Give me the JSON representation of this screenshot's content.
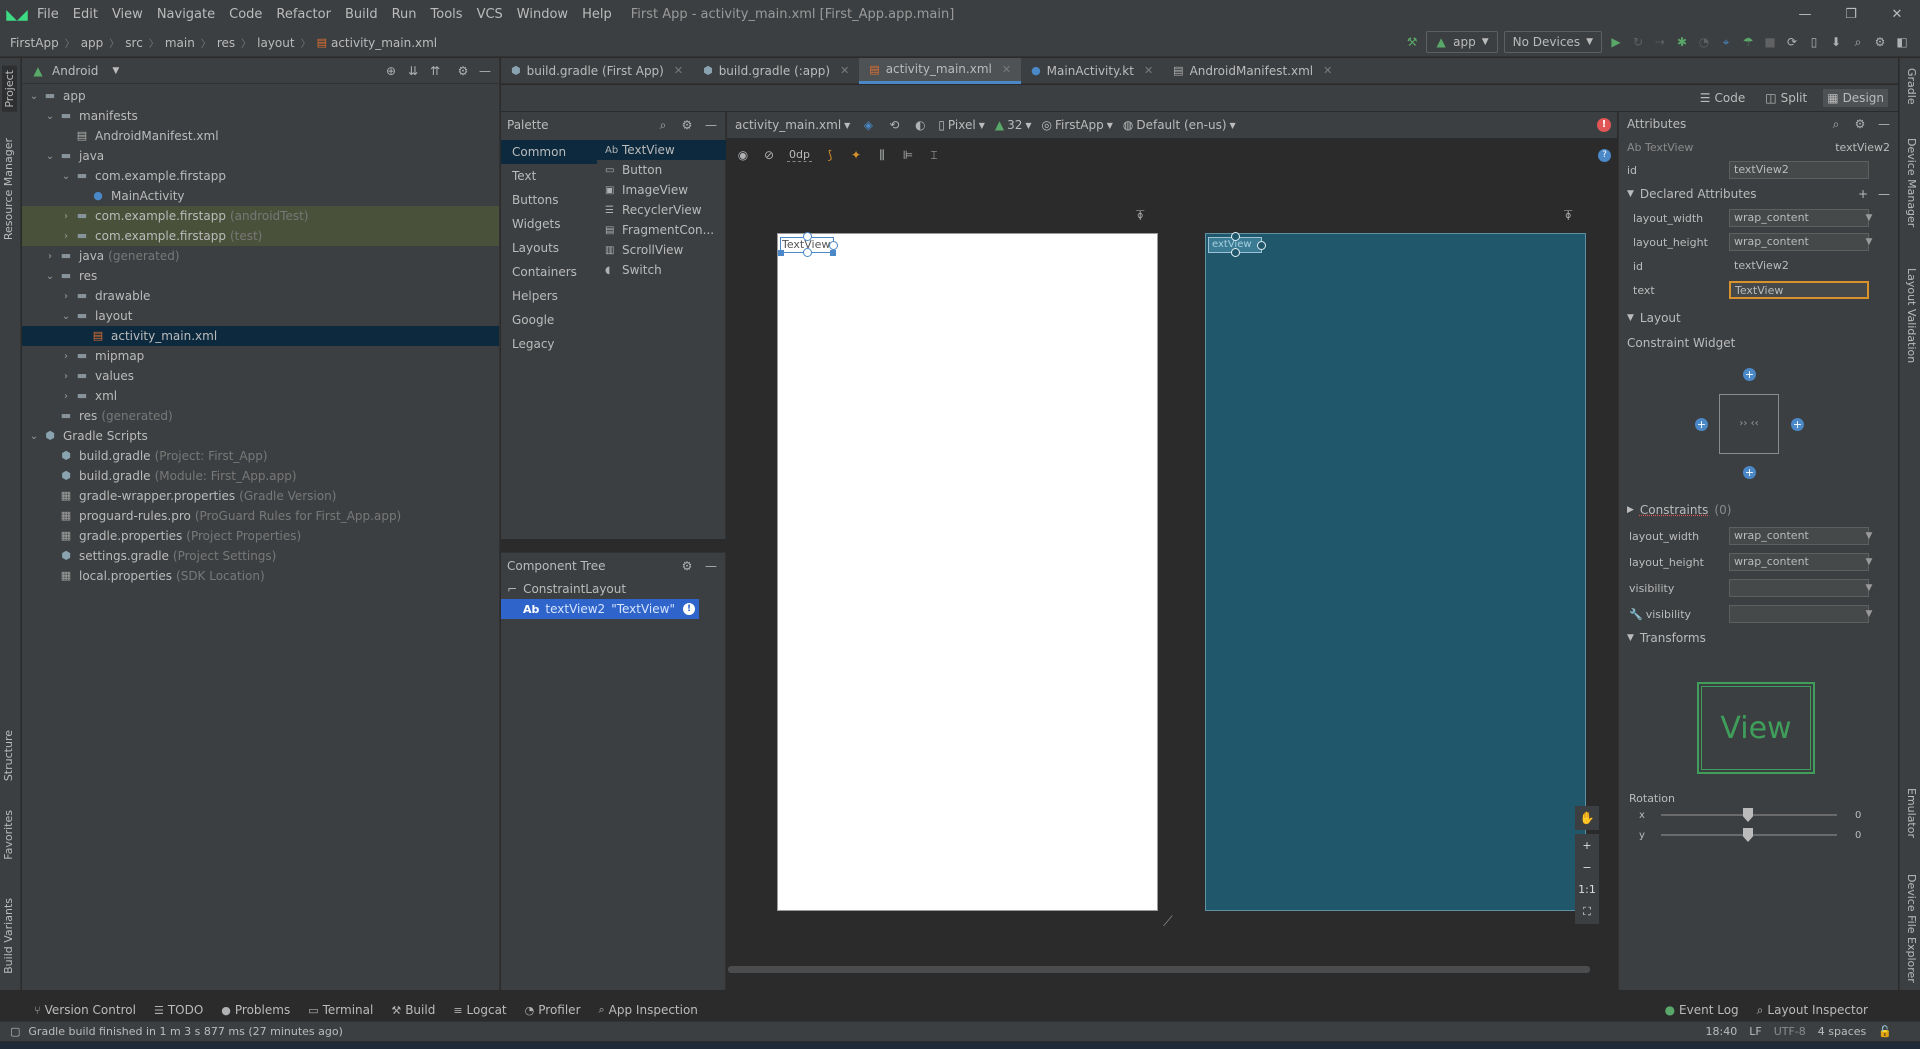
{
  "titlebar": {
    "menus": [
      "File",
      "Edit",
      "View",
      "Navigate",
      "Code",
      "Refactor",
      "Build",
      "Run",
      "Tools",
      "VCS",
      "Window",
      "Help"
    ],
    "title": "First App - activity_main.xml [First_App.app.main]"
  },
  "breadcrumb": [
    "FirstApp",
    "app",
    "src",
    "main",
    "res",
    "layout",
    "activity_main.xml"
  ],
  "toolbar": {
    "config": "app",
    "device": "No Devices"
  },
  "project": {
    "view": "Android",
    "tree": [
      {
        "label": "app",
        "dim": "",
        "depth": 0,
        "arrow": "v",
        "icon": "folder",
        "style": ""
      },
      {
        "label": "manifests",
        "dim": "",
        "depth": 1,
        "arrow": "v",
        "icon": "folder",
        "style": ""
      },
      {
        "label": "AndroidManifest.xml",
        "dim": "",
        "depth": 2,
        "arrow": "",
        "icon": "manifest",
        "style": ""
      },
      {
        "label": "java",
        "dim": "",
        "depth": 1,
        "arrow": "v",
        "icon": "folder",
        "style": ""
      },
      {
        "label": "com.example.firstapp",
        "dim": "",
        "depth": 2,
        "arrow": "v",
        "icon": "package",
        "style": ""
      },
      {
        "label": "MainActivity",
        "dim": "",
        "depth": 3,
        "arrow": "",
        "icon": "kotlin",
        "style": ""
      },
      {
        "label": "com.example.firstapp",
        "dim": "(androidTest)",
        "depth": 2,
        "arrow": ">",
        "icon": "package",
        "style": "hl"
      },
      {
        "label": "com.example.firstapp",
        "dim": "(test)",
        "depth": 2,
        "arrow": ">",
        "icon": "package",
        "style": "hl"
      },
      {
        "label": "java",
        "dim": "(generated)",
        "depth": 1,
        "arrow": ">",
        "icon": "folder",
        "style": ""
      },
      {
        "label": "res",
        "dim": "",
        "depth": 1,
        "arrow": "v",
        "icon": "folder",
        "style": ""
      },
      {
        "label": "drawable",
        "dim": "",
        "depth": 2,
        "arrow": ">",
        "icon": "folder",
        "style": ""
      },
      {
        "label": "layout",
        "dim": "",
        "depth": 2,
        "arrow": "v",
        "icon": "folder",
        "style": ""
      },
      {
        "label": "activity_main.xml",
        "dim": "",
        "depth": 3,
        "arrow": "",
        "icon": "layout",
        "style": "sel"
      },
      {
        "label": "mipmap",
        "dim": "",
        "depth": 2,
        "arrow": ">",
        "icon": "folder",
        "style": ""
      },
      {
        "label": "values",
        "dim": "",
        "depth": 2,
        "arrow": ">",
        "icon": "folder",
        "style": ""
      },
      {
        "label": "xml",
        "dim": "",
        "depth": 2,
        "arrow": ">",
        "icon": "folder",
        "style": ""
      },
      {
        "label": "res",
        "dim": "(generated)",
        "depth": 1,
        "arrow": "",
        "icon": "folder",
        "style": ""
      },
      {
        "label": "Gradle Scripts",
        "dim": "",
        "depth": 0,
        "arrow": "v",
        "icon": "gradle",
        "style": ""
      },
      {
        "label": "build.gradle",
        "dim": "(Project: First_App)",
        "depth": 1,
        "arrow": "",
        "icon": "gradle",
        "style": ""
      },
      {
        "label": "build.gradle",
        "dim": "(Module: First_App.app)",
        "depth": 1,
        "arrow": "",
        "icon": "gradle",
        "style": ""
      },
      {
        "label": "gradle-wrapper.properties",
        "dim": "(Gradle Version)",
        "depth": 1,
        "arrow": "",
        "icon": "props",
        "style": ""
      },
      {
        "label": "proguard-rules.pro",
        "dim": "(ProGuard Rules for First_App.app)",
        "depth": 1,
        "arrow": "",
        "icon": "props",
        "style": ""
      },
      {
        "label": "gradle.properties",
        "dim": "(Project Properties)",
        "depth": 1,
        "arrow": "",
        "icon": "props",
        "style": ""
      },
      {
        "label": "settings.gradle",
        "dim": "(Project Settings)",
        "depth": 1,
        "arrow": "",
        "icon": "gradle",
        "style": ""
      },
      {
        "label": "local.properties",
        "dim": "(SDK Location)",
        "depth": 1,
        "arrow": "",
        "icon": "props",
        "style": ""
      }
    ]
  },
  "tabs": [
    {
      "label": "build.gradle (First App)",
      "active": false
    },
    {
      "label": "build.gradle (:app)",
      "active": false
    },
    {
      "label": "activity_main.xml",
      "active": true
    },
    {
      "label": "MainActivity.kt",
      "active": false
    },
    {
      "label": "AndroidManifest.xml",
      "active": false
    }
  ],
  "designModes": [
    "Code",
    "Split",
    "Design"
  ],
  "palette": {
    "title": "Palette",
    "categories": [
      "Common",
      "Text",
      "Buttons",
      "Widgets",
      "Layouts",
      "Containers",
      "Helpers",
      "Google",
      "Legacy"
    ],
    "items": [
      {
        "icon": "Ab",
        "label": "TextView"
      },
      {
        "icon": "▭",
        "label": "Button"
      },
      {
        "icon": "▣",
        "label": "ImageView"
      },
      {
        "icon": "☰",
        "label": "RecyclerView"
      },
      {
        "icon": "▤",
        "label": "FragmentCon..."
      },
      {
        "icon": "▥",
        "label": "ScrollView"
      },
      {
        "icon": "◖",
        "label": "Switch"
      }
    ]
  },
  "componentTree": {
    "title": "Component Tree",
    "root": "ConstraintLayout",
    "child": "textView2",
    "childText": "\"TextView\""
  },
  "canvasToolbar": {
    "file": "activity_main.xml",
    "device": "Pixel",
    "api": "32",
    "theme": "FirstApp",
    "locale": "Default (en-us)",
    "margin": "0dp"
  },
  "canvas": {
    "designLabel": "TextView",
    "blueprintLabel": "extView",
    "zoomControls": [
      "+",
      "−",
      "1:1",
      "⛶"
    ]
  },
  "attributes": {
    "title": "Attributes",
    "widgetType": "Ab  TextView",
    "widgetId": "textView2",
    "idValue": "textView2",
    "declaredTitle": "Declared Attributes",
    "declared": [
      {
        "k": "layout_width",
        "v": "wrap_content",
        "dd": true,
        "focus": false
      },
      {
        "k": "layout_height",
        "v": "wrap_content",
        "dd": true,
        "focus": false
      },
      {
        "k": "id",
        "v": "textView2",
        "dd": false,
        "focus": false
      },
      {
        "k": "text",
        "v": "TextView",
        "dd": false,
        "focus": true
      }
    ],
    "layoutTitle": "Layout",
    "constraintWidget": "Constraint Widget",
    "constraintsTitle": "Constraints",
    "constraintsCount": "(0)",
    "layoutRows": [
      {
        "k": "layout_width",
        "v": "wrap_content"
      },
      {
        "k": "layout_height",
        "v": "wrap_content"
      },
      {
        "k": "visibility",
        "v": ""
      },
      {
        "k": "visibility",
        "v": ""
      }
    ],
    "transformsTitle": "Transforms",
    "viewPreview": "View",
    "rotation": "Rotation",
    "rotX": "x",
    "rotY": "y",
    "rotXVal": "0",
    "rotYVal": "0"
  },
  "leftTabs": [
    "Project",
    "Resource Manager",
    "Structure",
    "Favorites",
    "Build Variants"
  ],
  "rightTabs": [
    "Gradle",
    "Device Manager",
    "Layout Validation",
    "Emulator",
    "Device File Explorer"
  ],
  "bottomTools": [
    "Version Control",
    "TODO",
    "Problems",
    "Terminal",
    "Build",
    "Logcat",
    "Profiler",
    "App Inspection"
  ],
  "bottomRight": [
    "Event Log",
    "Layout Inspector"
  ],
  "status": {
    "message": "Gradle build finished in 1 m 3 s 877 ms (27 minutes ago)",
    "pos": "18:40",
    "lineSep": "LF",
    "encoding": "UTF-8",
    "indent": "4 spaces"
  },
  "colors": {
    "accent": "#4a88c7",
    "blueprint": "#21576b",
    "selection": "#0d293e",
    "warn": "#d8922b",
    "error": "#e05555"
  }
}
